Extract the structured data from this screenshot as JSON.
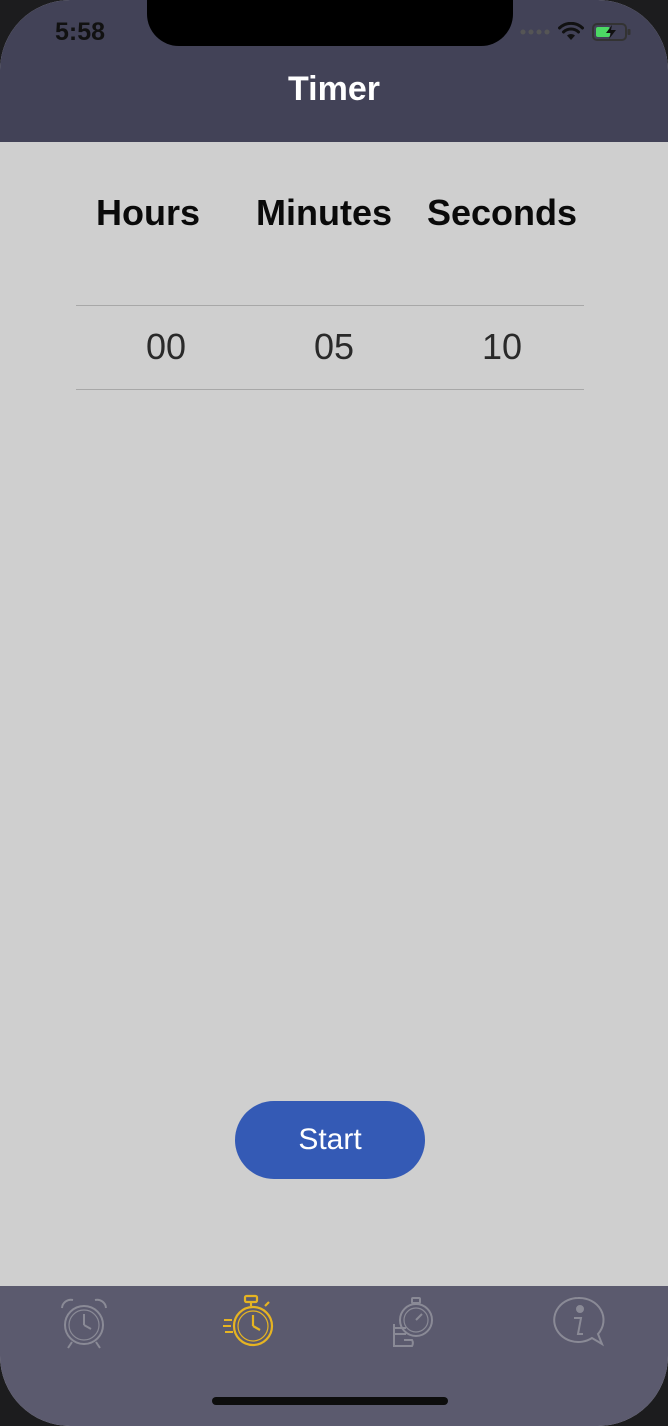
{
  "status_bar": {
    "time": "5:58",
    "icons": [
      "signal-dots-icon",
      "wifi-icon",
      "battery-charging-icon"
    ]
  },
  "nav": {
    "title": "Timer"
  },
  "picker": {
    "labels": {
      "hours": "Hours",
      "minutes": "Minutes",
      "seconds": "Seconds"
    },
    "values": {
      "hours": "00",
      "minutes": "05",
      "seconds": "10"
    }
  },
  "actions": {
    "start_label": "Start"
  },
  "tabbar": {
    "tabs": [
      {
        "icon": "alarm-clock-icon",
        "active": false
      },
      {
        "icon": "stopwatch-timer-icon",
        "active": true
      },
      {
        "icon": "hand-stopwatch-icon",
        "active": false
      },
      {
        "icon": "info-bubble-icon",
        "active": false
      }
    ],
    "active_color": "#e6b422",
    "inactive_color": "#8a8a96"
  },
  "colors": {
    "header_bg": "#424257",
    "content_bg": "#cfcfcf",
    "button_bg": "#345ab5",
    "tabbar_bg": "#5b5a6e"
  }
}
